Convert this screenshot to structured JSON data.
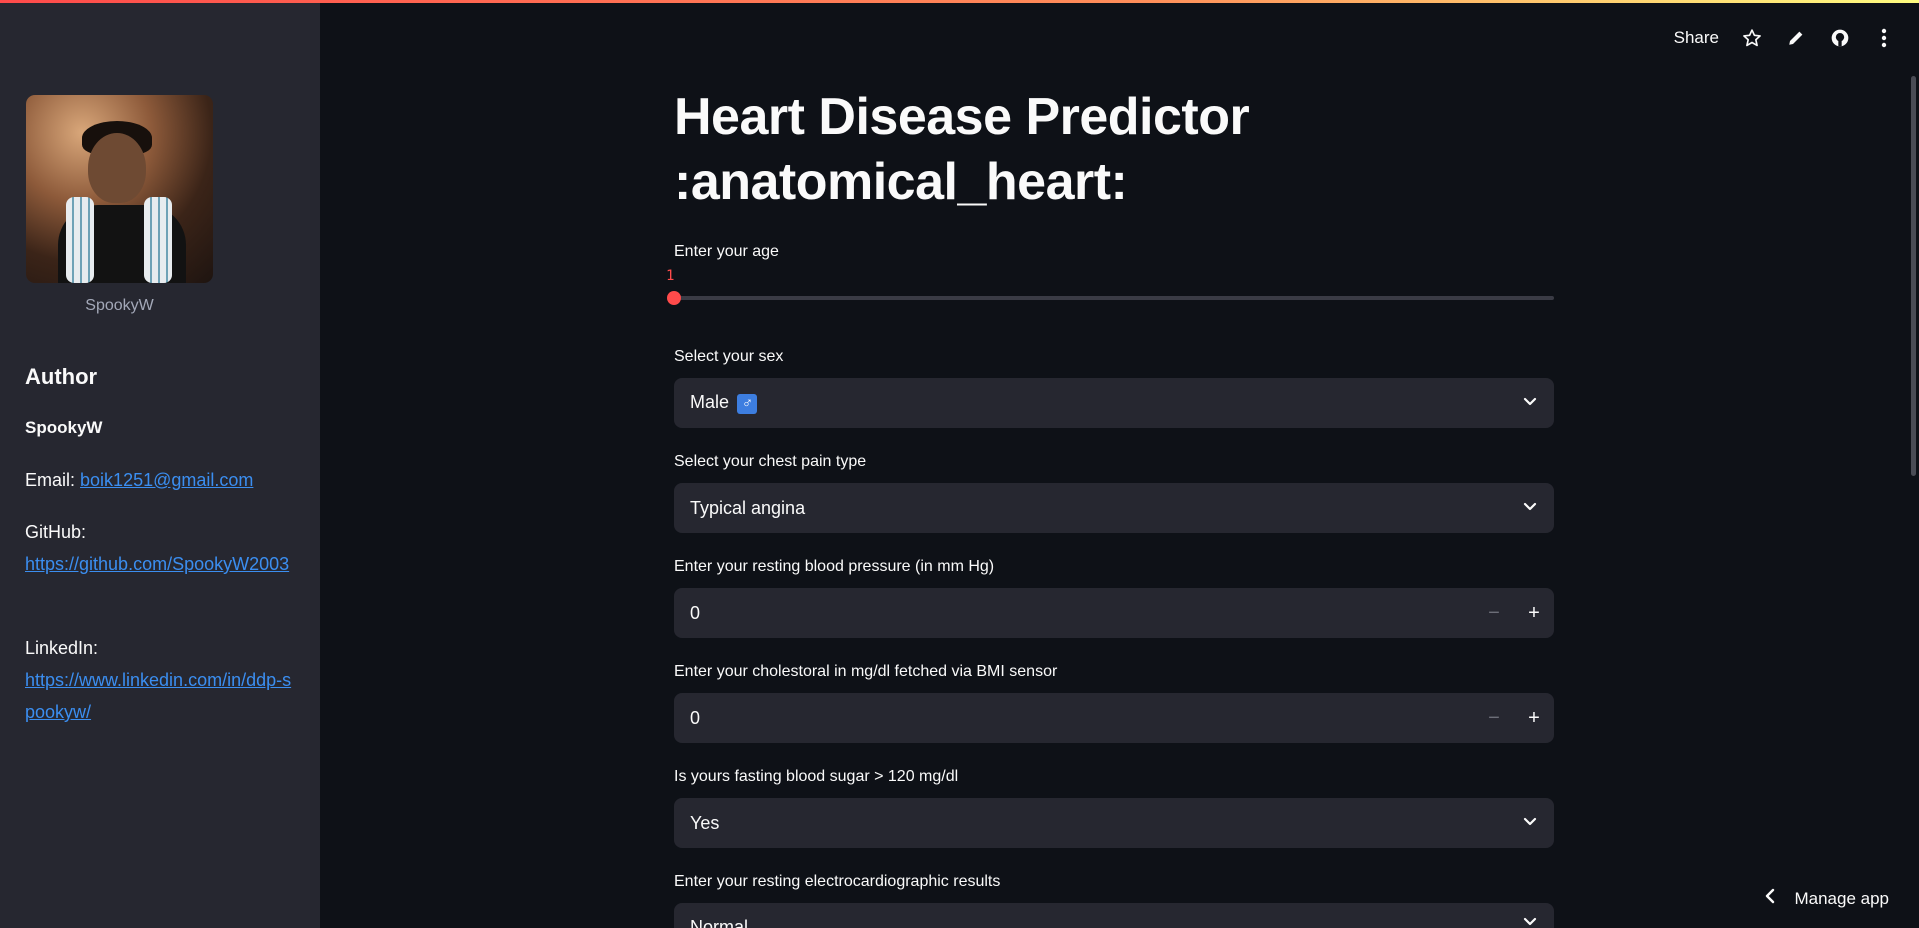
{
  "sidebar": {
    "avatar_caption": "SpookyW",
    "heading": "Author",
    "name": "SpookyW",
    "email_label": "Email:",
    "email": "boik1251@gmail.com",
    "github_label": "GitHub:",
    "github_url": "https://github.com/SpookyW2003",
    "linkedin_label": "LinkedIn:",
    "linkedin_url": "https://www.linkedin.com/in/ddp-spookyw/"
  },
  "toolbar": {
    "share_label": "Share",
    "icons": [
      "star-icon",
      "pencil-icon",
      "github-icon",
      "more-vertical-icon"
    ]
  },
  "main": {
    "title": "Heart Disease Predictor :anatomical_heart:",
    "age": {
      "label": "Enter your age",
      "value": "1"
    },
    "sex": {
      "label": "Select your sex",
      "value": "Male",
      "emoji": "♂"
    },
    "chest_pain": {
      "label": "Select your chest pain type",
      "value": "Typical angina"
    },
    "blood_pressure": {
      "label": "Enter your resting blood pressure (in mm Hg)",
      "value": "0"
    },
    "cholesterol": {
      "label": "Enter your cholestoral in mg/dl fetched via BMI sensor",
      "value": "0"
    },
    "fasting_sugar": {
      "label": "Is yours fasting blood sugar > 120 mg/dl",
      "value": "Yes"
    },
    "ecg": {
      "label": "Enter your resting electrocardiographic results",
      "value": "Normal"
    }
  },
  "footer": {
    "manage_label": "Manage app"
  },
  "colors": {
    "accent": "#ff4b4b",
    "link": "#3b8ef0",
    "background": "#0e1117",
    "sidebar": "#262730"
  }
}
